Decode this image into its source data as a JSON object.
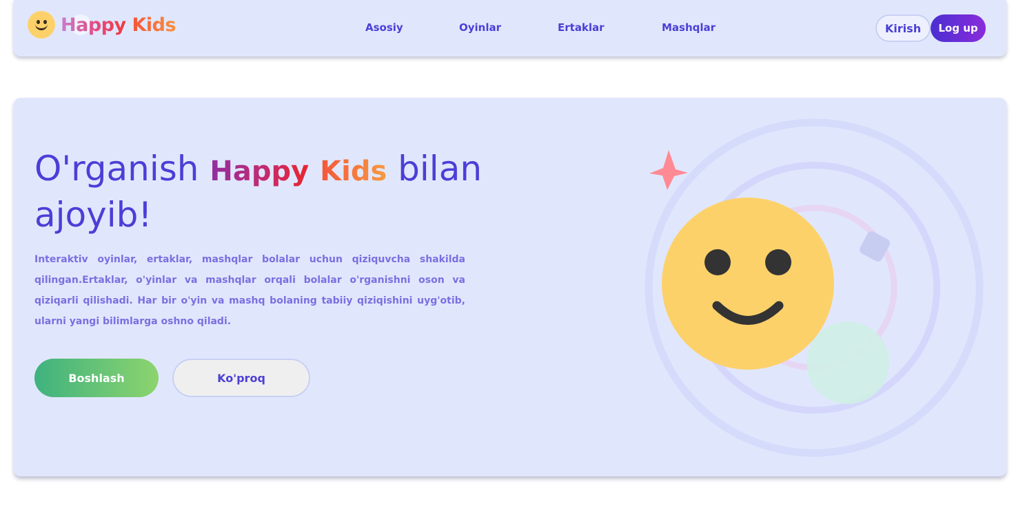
{
  "brand": {
    "word1": "Happy",
    "word2": "Kids",
    "logo_icon": "smiley-face-icon"
  },
  "nav": {
    "items": [
      {
        "label": "Asosiy"
      },
      {
        "label": "Oyinlar"
      },
      {
        "label": "Ertaklar"
      },
      {
        "label": "Mashqlar"
      }
    ],
    "login_label": "Kirish",
    "signup_label": "Log up"
  },
  "hero": {
    "title_before": "O'rganish",
    "title_brand1": "Happy",
    "title_brand2": "Kids",
    "title_after": "bilan ajoyib!",
    "description": "Interaktiv oyinlar, ertaklar, mashqlar bolalar uchun qiziquvcha shakilda qilingan.Ertaklar, o'yinlar va mashqlar orqali bolalar o'rganishni oson va qiziqarli qilishadi. Har bir o'yin va mashq bolaning tabiiy qiziqishini uyg'otib, ularni yangi bilimlarga oshno qiladi.",
    "primary_button": "Boshlash",
    "secondary_button": "Ko'proq",
    "illustration_icons": [
      "smiley-face-icon",
      "star-icon",
      "rounded-square-shape"
    ]
  },
  "colors": {
    "primary": "#4b3fd6",
    "background": "#e0e7fd",
    "green_start": "#3fb27f",
    "green_end": "#8cd46e",
    "purple_start": "#4a2fd1",
    "purple_end": "#8a2bdb",
    "smiley": "#fdd16a",
    "star": "#ff8a94"
  }
}
